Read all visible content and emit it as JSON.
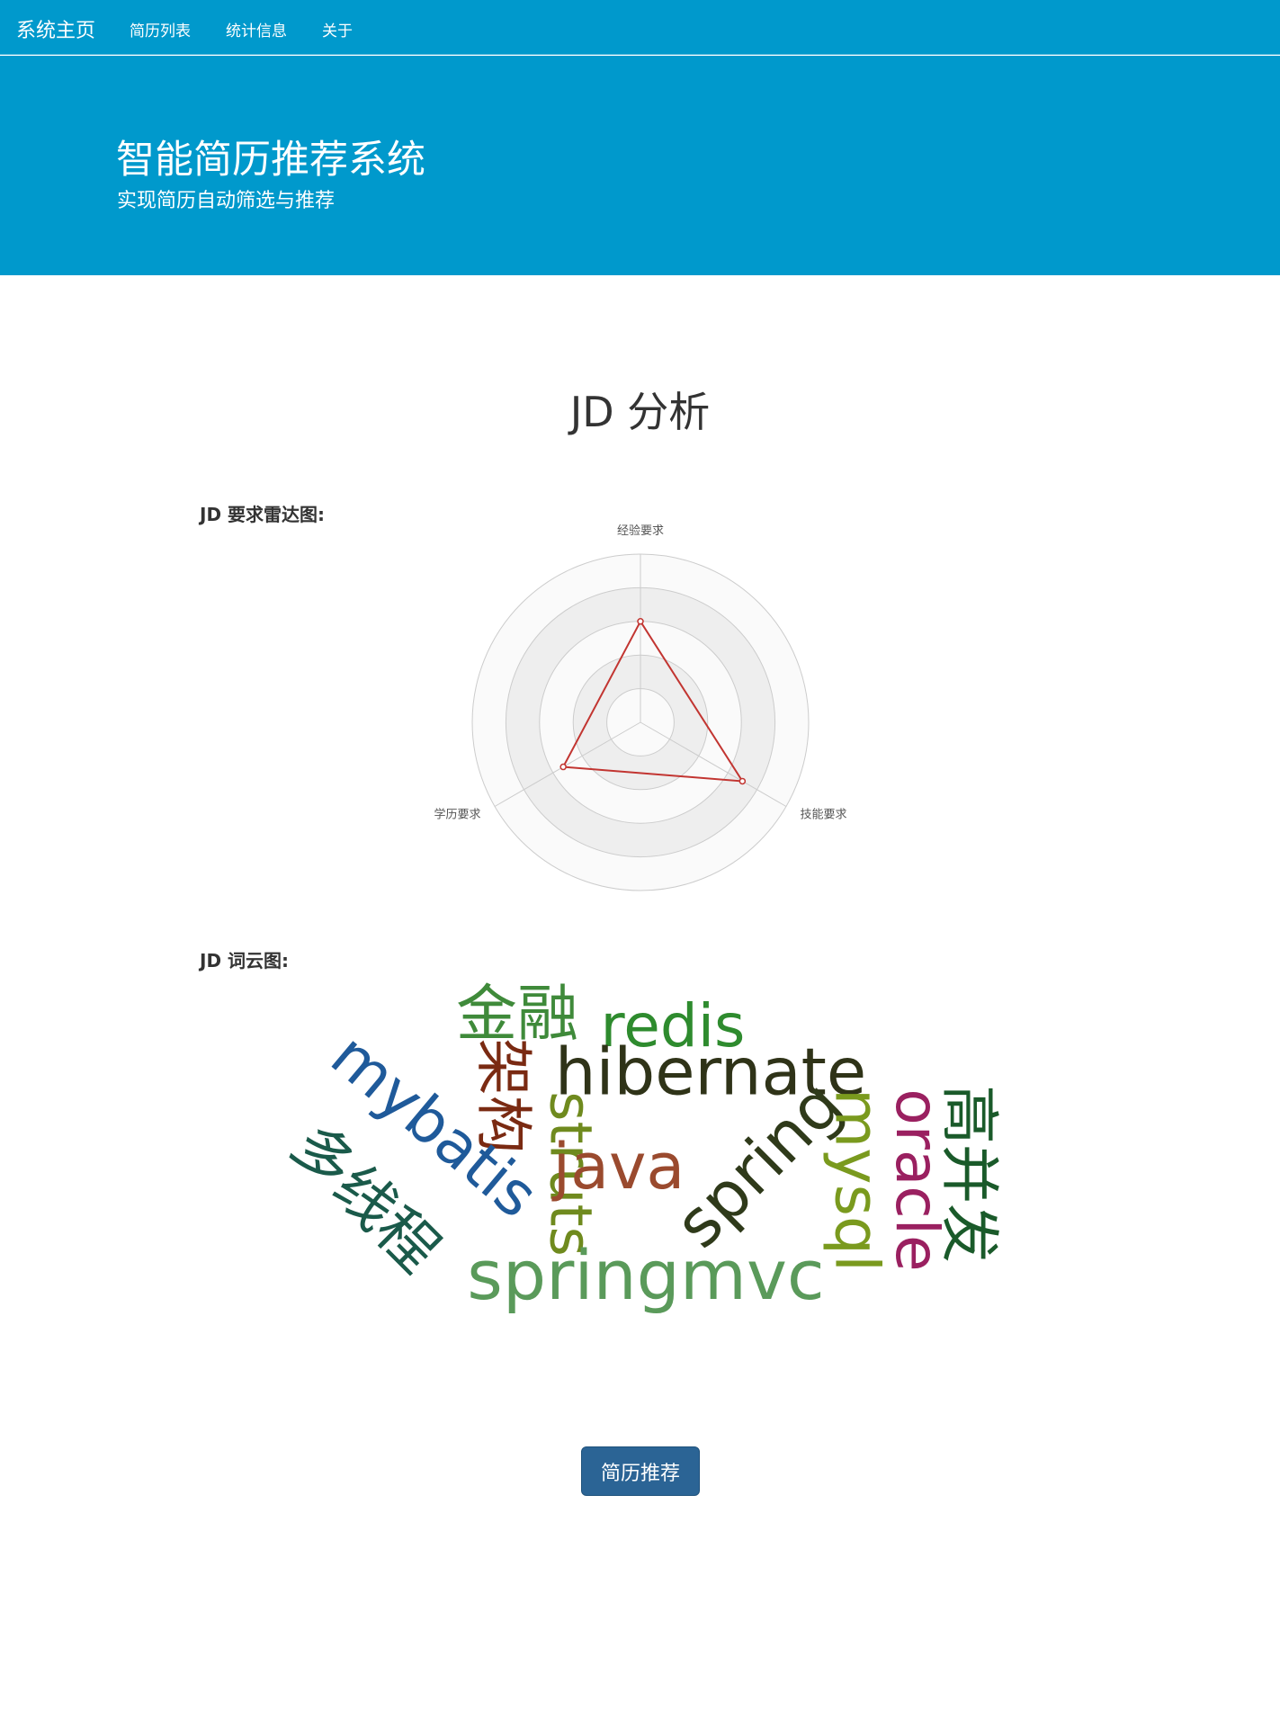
{
  "navbar": {
    "brand": "系统主页",
    "links": [
      "简历列表",
      "统计信息",
      "关于"
    ]
  },
  "hero": {
    "title": "智能简历推荐系统",
    "subtitle": "实现简历自动筛选与推荐"
  },
  "main": {
    "title": "JD 分析",
    "radar_label": "JD 要求雷达图:",
    "wordcloud_label": "JD 词云图:",
    "recommend_button": "简历推荐"
  },
  "colors": {
    "navbar_bg": "#0099cc",
    "radar_line": "#c23531",
    "button_bg": "#2b6495"
  },
  "chart_data": [
    {
      "type": "radar",
      "indicators": [
        "经验要求",
        "技能要求",
        "学历要求"
      ],
      "max": 1,
      "series": [
        {
          "values": [
            0.6,
            0.7,
            0.53
          ]
        }
      ],
      "rings": 5
    },
    {
      "type": "wordcloud",
      "words": [
        {
          "text": "金融",
          "color": "#3f8a3a"
        },
        {
          "text": "redis",
          "color": "#2e8b2e"
        },
        {
          "text": "hibernate",
          "color": "#2f3318"
        },
        {
          "text": "架构",
          "color": "#7a2a12"
        },
        {
          "text": "struts",
          "color": "#6f8a1e"
        },
        {
          "text": "java",
          "color": "#9a4a2e"
        },
        {
          "text": "spring",
          "color": "#2f3a1a"
        },
        {
          "text": "mysql",
          "color": "#7a9a1e"
        },
        {
          "text": "oracle",
          "color": "#9a2060"
        },
        {
          "text": "高并发",
          "color": "#1a5a2a"
        },
        {
          "text": "mybatis",
          "color": "#1f5a9a"
        },
        {
          "text": "多线程",
          "color": "#1a5a4a"
        },
        {
          "text": "springmvc",
          "color": "#5a9a5a"
        }
      ]
    }
  ]
}
